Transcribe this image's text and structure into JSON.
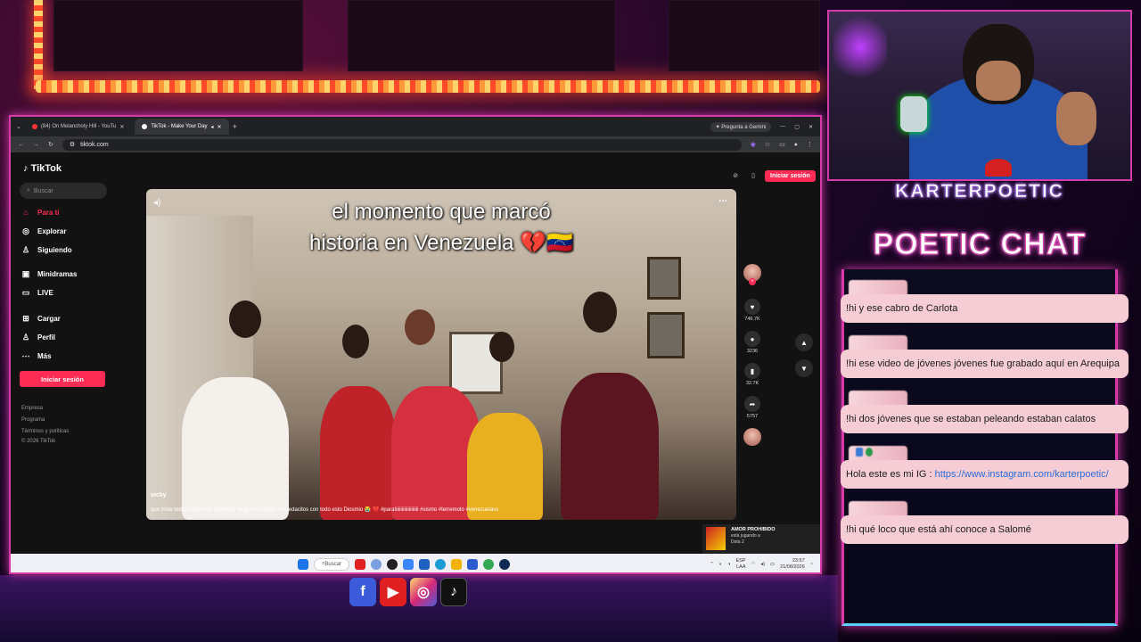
{
  "browser": {
    "tabs": [
      {
        "label": "(84) On Melancholy Hill - YouTu",
        "active": false,
        "icon_color": "#ff3333"
      },
      {
        "label": "TikTok - Make Your Day",
        "active": true,
        "icon_color": "#ffffff"
      }
    ],
    "new_tab": "+",
    "gemini": "Pregunta a Gemini",
    "url": "tiktok.com"
  },
  "tiktok": {
    "logo": "TikTok",
    "search_placeholder": "Buscar",
    "nav": [
      {
        "label": "Para ti",
        "icon": "home-icon",
        "glyph": "⌂",
        "active": true
      },
      {
        "label": "Explorar",
        "icon": "compass-icon",
        "glyph": "◎",
        "active": false
      },
      {
        "label": "Siguiendo",
        "icon": "following-icon",
        "glyph": "♙",
        "active": false
      },
      {
        "label": "Minidramas",
        "icon": "minidrama-icon",
        "glyph": "▣",
        "active": false
      },
      {
        "label": "LIVE",
        "icon": "live-icon",
        "glyph": "▭",
        "active": false
      },
      {
        "label": "Cargar",
        "icon": "upload-icon",
        "glyph": "⊞",
        "active": false
      },
      {
        "label": "Perfil",
        "icon": "profile-icon",
        "glyph": "♙",
        "active": false
      },
      {
        "label": "Más",
        "icon": "more-icon",
        "glyph": "⋯",
        "active": false
      }
    ],
    "login": "Iniciar sesión",
    "footer": [
      "Empresa",
      "Programa",
      "Términos y políticas",
      "© 2026 TikTok"
    ],
    "top_login": "Iniciar sesión"
  },
  "video": {
    "caption_line1": "el momento que marcó",
    "caption_line2": "historia en Venezuela 💔🇻🇪",
    "user": "vicky",
    "description": "que triste todo lo que está pasando, tengo el corazón en pedacitos con todo esto Diosmio 😭 💔 #paratiiiiiiiiiiiiiiiiiii #sismo #terremoto #venezuelavs",
    "likes": "746.7K",
    "comments": "3236",
    "saves": "32.7K",
    "shares": "5757"
  },
  "now_playing": {
    "title": "AMOR PROHIBIDO",
    "line2": "está jugando a",
    "line3": "Dota 2"
  },
  "taskbar": {
    "search": "Buscar",
    "lang1": "ESP",
    "lang2": "LAA",
    "time": "23:57",
    "date": "21/08/2026"
  },
  "stream": {
    "name": "KARTERPOETIC",
    "chat_title": "POETIC CHAT",
    "messages": [
      {
        "text": "!hi y ese cabro de Carlota",
        "has_badges": false
      },
      {
        "text": "!hi ese video de jóvenes jóvenes fue grabado aquí en Arequipa",
        "has_badges": false
      },
      {
        "text": "!hi dos jóvenes que se estaban peleando estaban calatos",
        "has_badges": false
      },
      {
        "text_prefix": "Hola este es mi IG : ",
        "link": "https://www.instagram.com/karterpoetic/",
        "has_badges": true
      },
      {
        "text": "!hi qué loco que está ahí conoce a Salomé",
        "has_badges": false
      }
    ]
  },
  "colors": {
    "accent": "#d63aa8",
    "tiktok_red": "#fe2c55",
    "chat_bubble": "#f6cdd5"
  }
}
